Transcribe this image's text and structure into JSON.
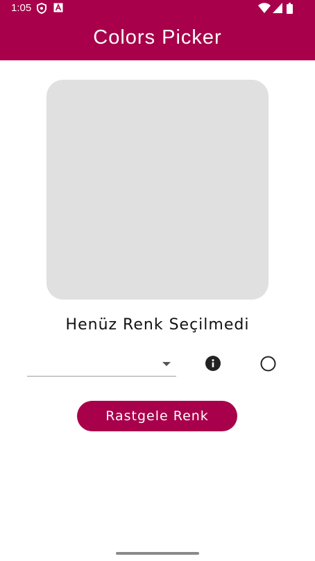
{
  "status_bar": {
    "time": "1:05",
    "icons": [
      "shield-icon",
      "a-badge-icon",
      "wifi-icon",
      "signal-icon",
      "battery-icon"
    ]
  },
  "app": {
    "title": "Colors Picker",
    "accent_color": "#a8004a"
  },
  "preview": {
    "color": "#e0e0e0"
  },
  "status": {
    "text": "Henüz Renk Seçilmedi"
  },
  "dropdown": {
    "value": ""
  },
  "random_button": {
    "label": "Rastgele Renk"
  }
}
